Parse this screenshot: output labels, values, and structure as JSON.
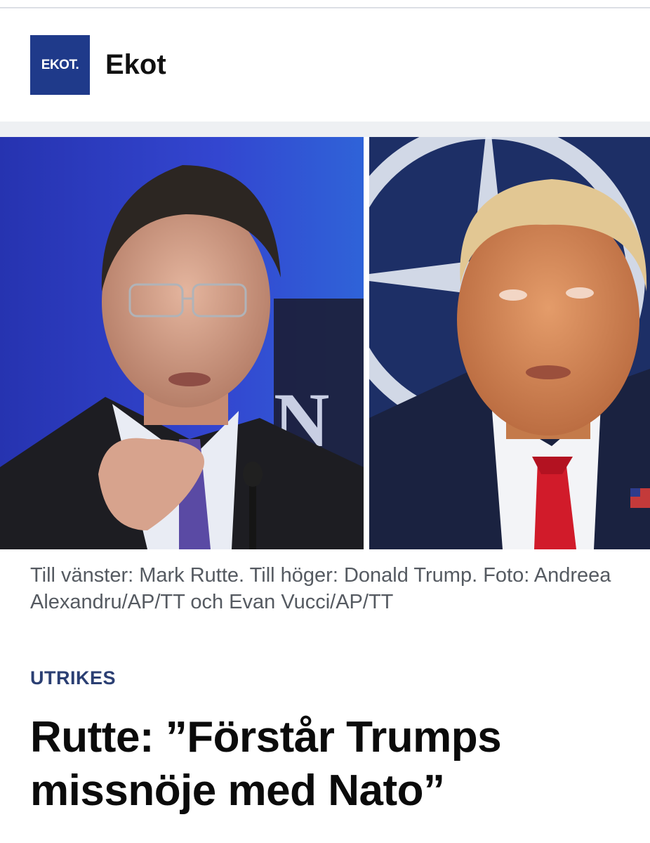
{
  "header": {
    "logo_text": "EKOT.",
    "brand_name": "Ekot"
  },
  "photos": {
    "left_icon": "person-photo",
    "right_icon": "person-photo"
  },
  "article": {
    "caption": "Till vänster: Mark Rutte. Till höger: Donald Trump. Foto: Andreea Alexandru/AP/TT och Evan Vucci/AP/TT",
    "category": "UTRIKES",
    "headline": "Rutte: ”Förstår Trumps missnöje med Nato”"
  },
  "colors": {
    "logo_bg": "#1f3a8a",
    "kicker": "#2b3f73",
    "caption": "#555a61",
    "headline": "#0b0b0b"
  }
}
